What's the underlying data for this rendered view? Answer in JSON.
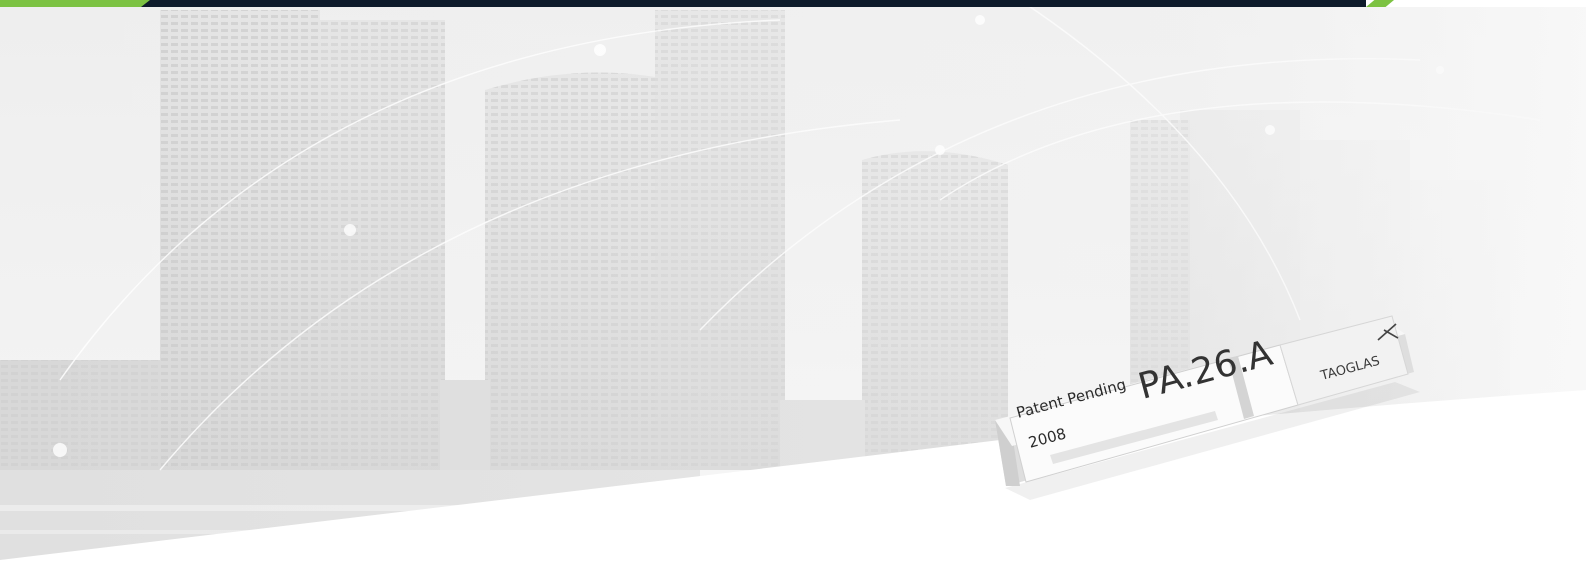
{
  "scene": {
    "description_colors": {
      "accent_green": "#7cc242",
      "top_bar": "#0e1b2b",
      "background": "#f2f2f2"
    }
  },
  "product": {
    "patent_label": "Patent Pending",
    "model": "PA.26.A",
    "year": "2008",
    "brand": "TAOGLAS"
  },
  "icons": {
    "brand_mark": "taoglas-logo-icon"
  }
}
